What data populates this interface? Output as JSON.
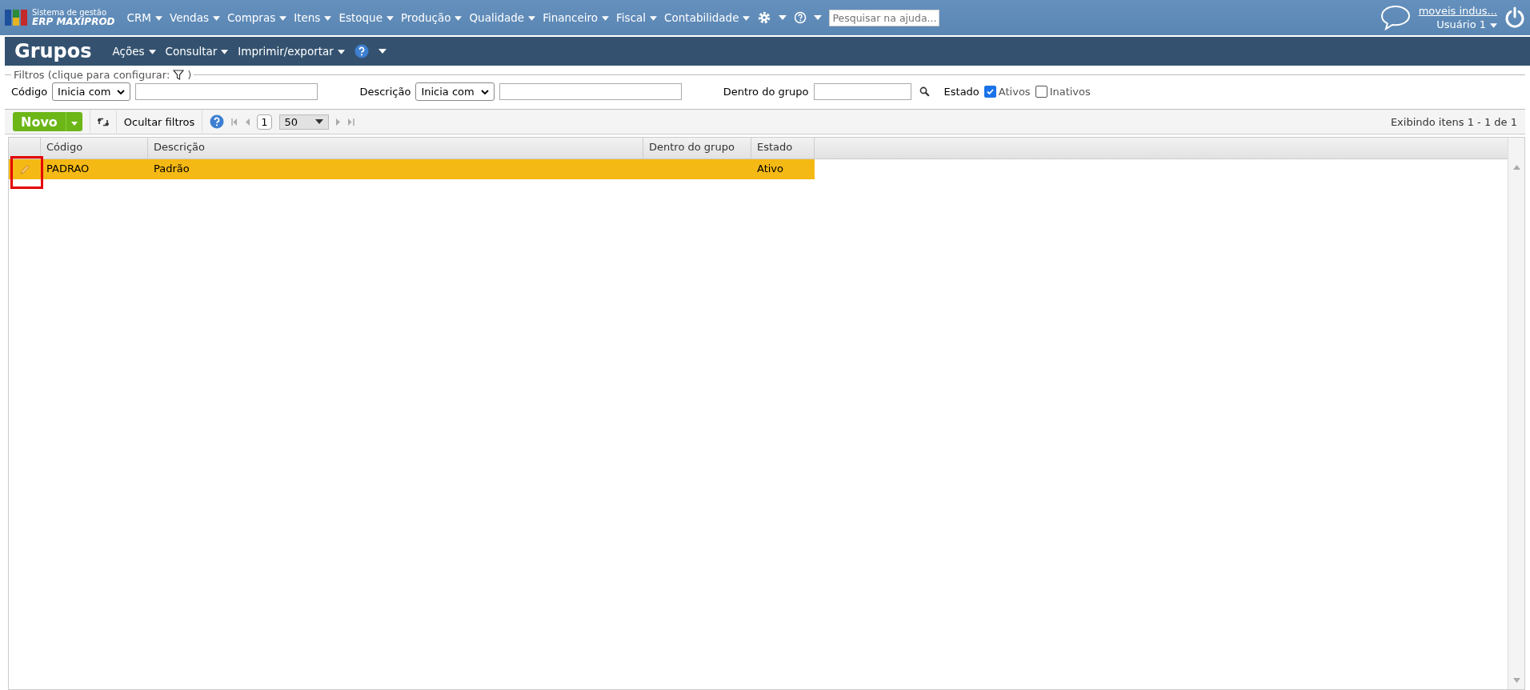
{
  "app": {
    "logo_line_1": "Sistema de gestão",
    "logo_line_2": "ERP MAXIPROD"
  },
  "menu": [
    "CRM",
    "Vendas",
    "Compras",
    "Itens",
    "Estoque",
    "Produção",
    "Qualidade",
    "Financeiro",
    "Fiscal",
    "Contabilidade"
  ],
  "help_search": {
    "placeholder": "Pesquisar na ajuda..."
  },
  "user": {
    "company": "moveis indus...",
    "name": "Usuário 1"
  },
  "page": {
    "title": "Grupos",
    "actions": [
      "Ações",
      "Consultar",
      "Imprimir/exportar"
    ]
  },
  "filters": {
    "legend": "Filtros (clique para configurar:",
    "legend_end": ")",
    "fields": [
      {
        "kind": "select",
        "label": "Código",
        "option": "Inicia com"
      },
      {
        "kind": "select",
        "label": "Descrição",
        "option": "Inicia com"
      },
      {
        "kind": "lookup",
        "label": "Dentro do grupo"
      }
    ],
    "state_label": "Estado",
    "states": [
      {
        "label": "Ativos",
        "checked": true
      },
      {
        "label": "Inativos",
        "checked": false
      }
    ]
  },
  "toolbar": {
    "new_button": "Novo",
    "hide_filters": "Ocultar filtros",
    "page": "1",
    "page_size": "50",
    "summary": "Exibindo itens 1 - 1 de 1"
  },
  "table": {
    "columns": [
      "Código",
      "Descrição",
      "Dentro do grupo",
      "Estado"
    ],
    "rows": [
      {
        "selected": true,
        "cells": [
          "PADRAO",
          "Padrão",
          "",
          "Ativo"
        ]
      }
    ]
  }
}
